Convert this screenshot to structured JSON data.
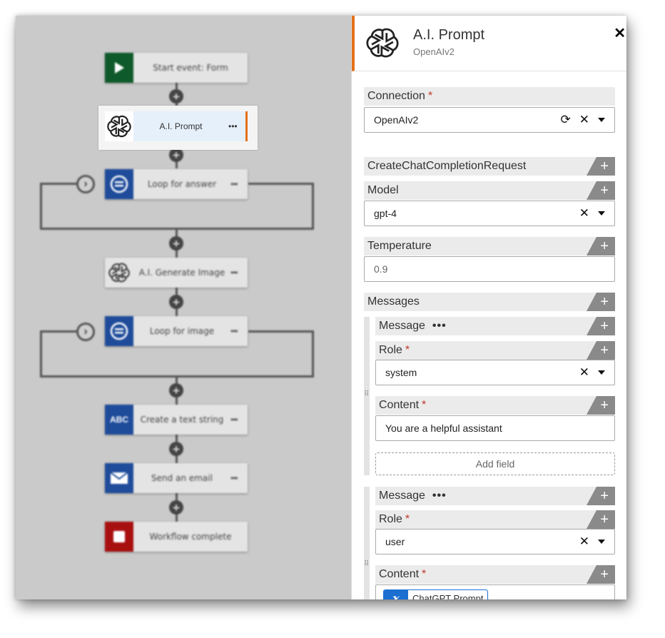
{
  "workflow": {
    "nodes": [
      {
        "label": "Start event: Form",
        "icon": "play-icon",
        "color": "#0f5a2a"
      },
      {
        "label": "A.I. Prompt",
        "icon": "openai-icon"
      },
      {
        "label": "Loop for answer",
        "icon": "loop-icon",
        "color": "#1e4b9a"
      },
      {
        "label": "A.I. Generate Image",
        "icon": "openai-icon"
      },
      {
        "label": "Loop for image",
        "icon": "loop-icon",
        "color": "#1e4b9a"
      },
      {
        "label": "Create a text string",
        "icon": "abc-icon",
        "color": "#1e4b9a",
        "icon_text": "ABC"
      },
      {
        "label": "Send an email",
        "icon": "envelope-icon",
        "color": "#1e4b9a"
      },
      {
        "label": "Workflow complete",
        "icon": "stop-icon",
        "color": "#a81010"
      }
    ],
    "more": "•••",
    "selected_accent": "#e3711a"
  },
  "panel": {
    "title": "A.I. Prompt",
    "subtitle": "OpenAIv2",
    "close": "✕",
    "connection": {
      "label": "Connection",
      "required": "*",
      "value": "OpenAIv2"
    },
    "request": {
      "label": "CreateChatCompletionRequest"
    },
    "model": {
      "label": "Model",
      "value": "gpt-4"
    },
    "temperature": {
      "label": "Temperature",
      "value": "0.9"
    },
    "messages": {
      "label": "Messages"
    },
    "message1": {
      "label": "Message",
      "more": "•••",
      "role_label": "Role",
      "role_value": "system",
      "content_label": "Content",
      "content_value": "You are a helpful assistant",
      "add_field": "Add field"
    },
    "message2": {
      "label": "Message",
      "more": "•••",
      "role_label": "Role",
      "role_value": "user",
      "content_label": "Content",
      "token_label": "ChatGPT Prompt",
      "token_glyph": "x"
    },
    "required_mark": "*",
    "add": "+"
  }
}
